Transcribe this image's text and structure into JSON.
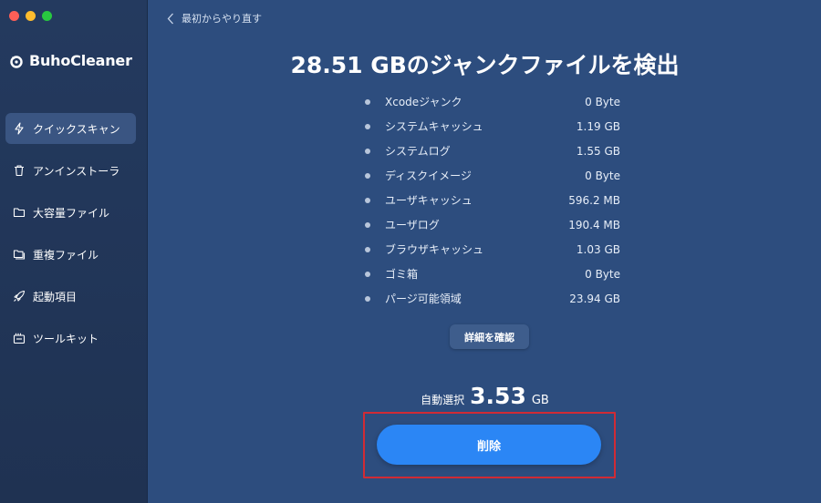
{
  "window": {
    "controls": [
      "close",
      "minimize",
      "zoom"
    ]
  },
  "brand": {
    "name": "BuhoCleaner",
    "logo_icon": "buho-logo-icon"
  },
  "sidebar": {
    "items": [
      {
        "label": "クイックスキャン",
        "icon": "lightning-icon",
        "active": true
      },
      {
        "label": "アンインストーラ",
        "icon": "trash-icon",
        "active": false
      },
      {
        "label": "大容量ファイル",
        "icon": "folder-icon",
        "active": false
      },
      {
        "label": "重複ファイル",
        "icon": "duplicate-folder-icon",
        "active": false
      },
      {
        "label": "起動項目",
        "icon": "rocket-icon",
        "active": false
      },
      {
        "label": "ツールキット",
        "icon": "toolkit-icon",
        "active": false
      }
    ]
  },
  "header": {
    "back_label": "最初からやり直す"
  },
  "main": {
    "title_number": "28.51",
    "title_text": " GBのジャンクファイルを検出",
    "items": [
      {
        "label": "Xcodeジャンク",
        "size": "0 Byte"
      },
      {
        "label": "システムキャッシュ",
        "size": "1.19 GB"
      },
      {
        "label": "システムログ",
        "size": "1.55 GB"
      },
      {
        "label": "ディスクイメージ",
        "size": "0 Byte"
      },
      {
        "label": "ユーザキャッシュ",
        "size": "596.2 MB"
      },
      {
        "label": "ユーザログ",
        "size": "190.4 MB"
      },
      {
        "label": "ブラウザキャッシュ",
        "size": "1.03 GB"
      },
      {
        "label": "ゴミ箱",
        "size": "0 Byte"
      },
      {
        "label": "パージ可能領域",
        "size": "23.94 GB"
      }
    ],
    "details_button": "詳細を確認",
    "auto_select_label": "自動選択",
    "auto_select_value": "3.53",
    "auto_select_unit": "GB",
    "delete_button": "削除"
  },
  "colors": {
    "main_bg": "#2d4d7e",
    "sidebar_bg": "#243a5f",
    "accent": "#2b86f5",
    "highlight": "#d02b35"
  }
}
